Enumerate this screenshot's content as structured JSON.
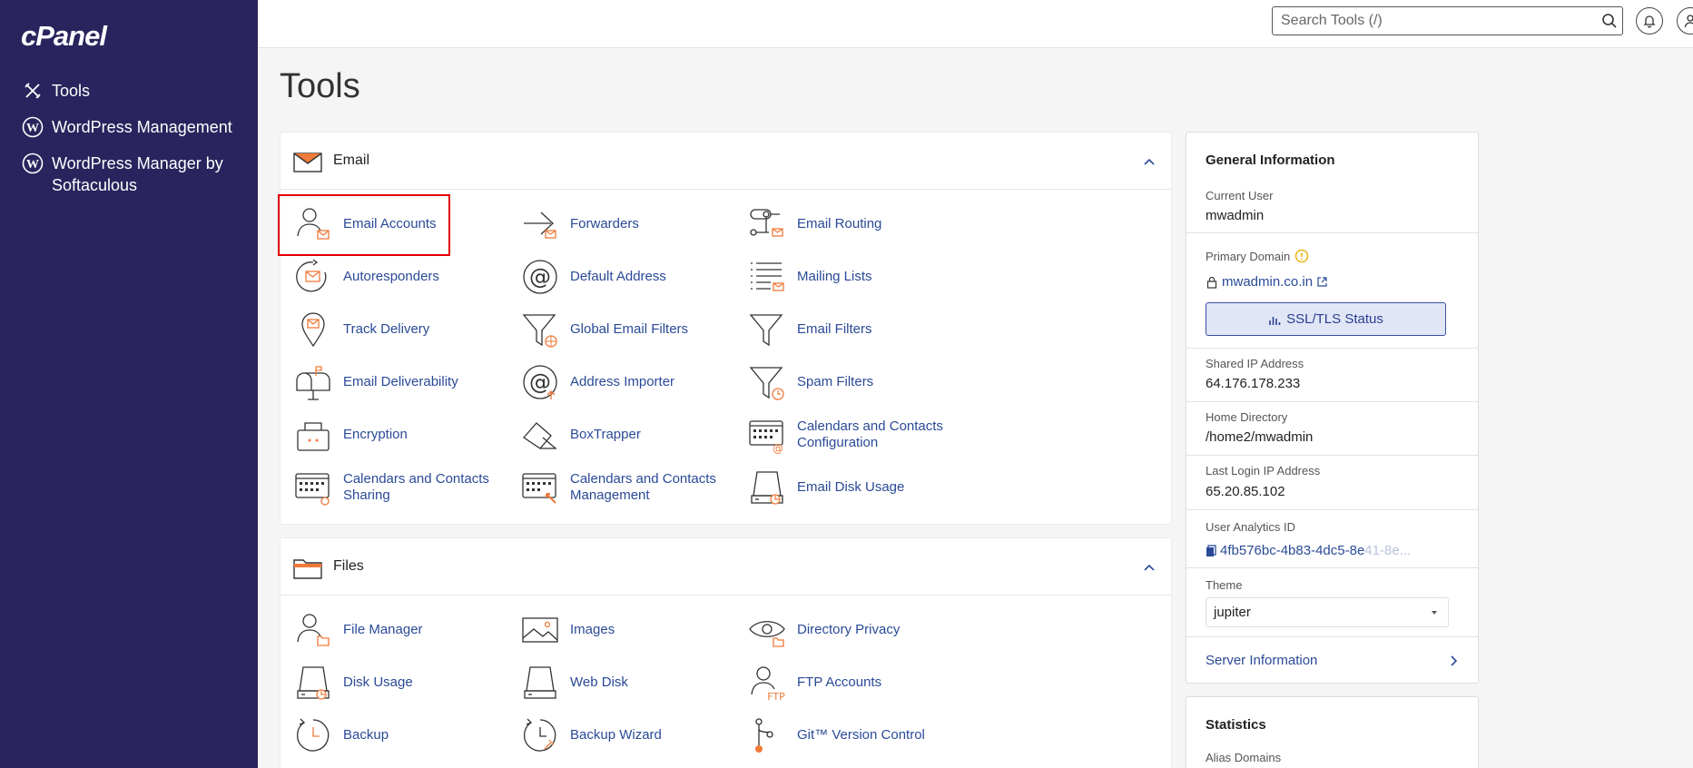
{
  "sidebar": {
    "logo": "cPanel",
    "items": [
      {
        "label": "Tools"
      },
      {
        "label": "WordPress Management"
      },
      {
        "label": "WordPress Manager by Softaculous"
      }
    ]
  },
  "topbar": {
    "search_placeholder": "Search Tools (/)"
  },
  "page_title": "Tools",
  "email_panel": {
    "title": "Email",
    "tools": [
      {
        "label": "Email Accounts"
      },
      {
        "label": "Forwarders"
      },
      {
        "label": "Email Routing"
      },
      {
        "label": "Autoresponders"
      },
      {
        "label": "Default Address"
      },
      {
        "label": "Mailing Lists"
      },
      {
        "label": "Track Delivery"
      },
      {
        "label": "Global Email Filters"
      },
      {
        "label": "Email Filters"
      },
      {
        "label": "Email Deliverability"
      },
      {
        "label": "Address Importer"
      },
      {
        "label": "Spam Filters"
      },
      {
        "label": "Encryption"
      },
      {
        "label": "BoxTrapper"
      },
      {
        "label": "Calendars and Contacts Configuration"
      },
      {
        "label": "Calendars and Contacts Sharing"
      },
      {
        "label": "Calendars and Contacts Management"
      },
      {
        "label": "Email Disk Usage"
      }
    ]
  },
  "files_panel": {
    "title": "Files",
    "tools": [
      {
        "label": "File Manager"
      },
      {
        "label": "Images"
      },
      {
        "label": "Directory Privacy"
      },
      {
        "label": "Disk Usage"
      },
      {
        "label": "Web Disk"
      },
      {
        "label": "FTP Accounts"
      },
      {
        "label": "Backup"
      },
      {
        "label": "Backup Wizard"
      },
      {
        "label": "Git™ Version Control"
      }
    ]
  },
  "general_info": {
    "title": "General Information",
    "current_user_label": "Current User",
    "current_user": "mwadmin",
    "primary_domain_label": "Primary Domain",
    "primary_domain": "mwadmin.co.in",
    "ssl_button": "SSL/TLS Status",
    "shared_ip_label": "Shared IP Address",
    "shared_ip": "64.176.178.233",
    "home_dir_label": "Home Directory",
    "home_dir": "/home2/mwadmin",
    "last_login_label": "Last Login IP Address",
    "last_login": "65.20.85.102",
    "analytics_label": "User Analytics ID",
    "analytics_id": "4fb576bc-4b83-4dc5-8e",
    "analytics_id_faded": "41-8e...",
    "theme_label": "Theme",
    "theme_value": "jupiter",
    "server_info": "Server Information"
  },
  "statistics": {
    "title": "Statistics",
    "alias_domains_label": "Alias Domains"
  },
  "colors": {
    "sidebar_bg": "#29245d",
    "link": "#2a4a97",
    "accent_orange": "#f07a3a",
    "highlight_red": "#e30000"
  }
}
